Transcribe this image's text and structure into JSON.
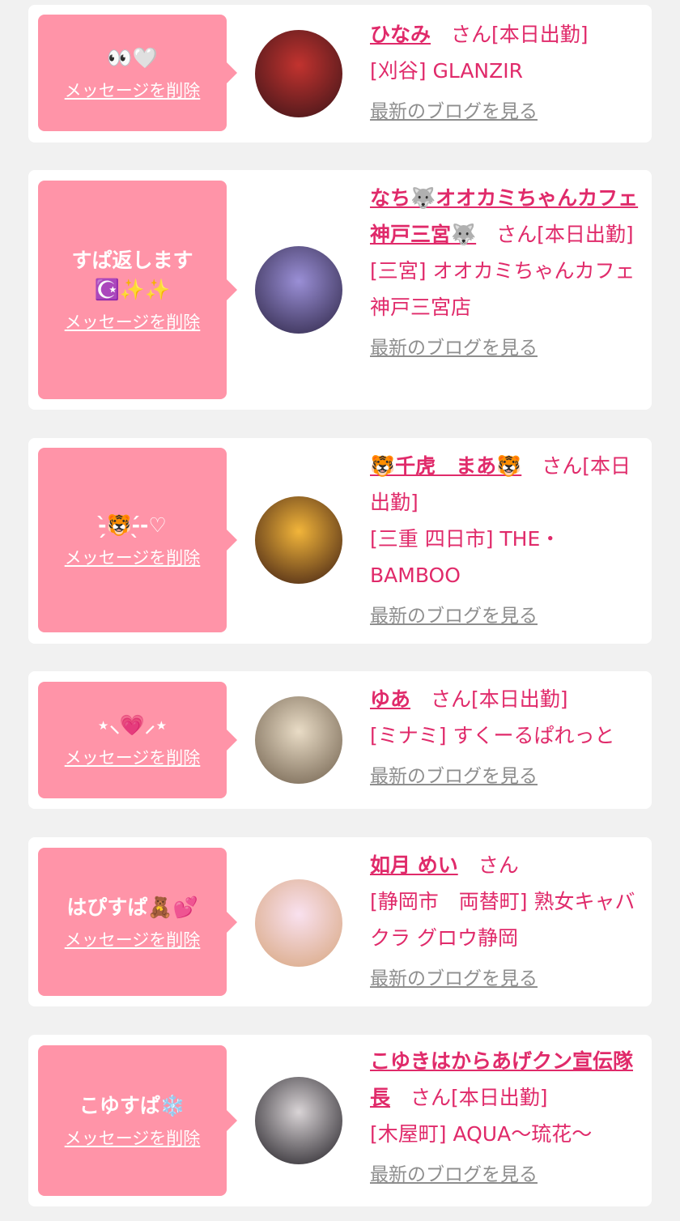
{
  "cards": [
    {
      "bubble_text": "👀🤍",
      "delete_label": "メッセージを削除",
      "name": "ひなみ",
      "suffix": "　さん[本日出勤]",
      "shop": "[刈谷] GLANZIR",
      "blog_label": "最新のブログを見る",
      "avatar_colors": [
        "#c2332f",
        "#3a1418"
      ]
    },
    {
      "bubble_text": "すぱ返します☪️✨✨",
      "delete_label": "メッセージを削除",
      "name": "なち🐺オオカミちゃんカフェ神戸三宮🐺",
      "suffix": "　さん[本日出勤]",
      "shop": "[三宮] オオカミちゃんカフェ神戸三宮店",
      "blog_label": "最新のブログを見る",
      "avatar_colors": [
        "#9a8fd6",
        "#2c2444"
      ]
    },
    {
      "bubble_text": "-̗̀🐯-̖́-♡",
      "delete_label": "メッセージを削除",
      "name": "🐯千虎　まあ🐯",
      "suffix": "　さん[本日出勤]",
      "shop": "[三重 四日市] THE・BAMBOO",
      "blog_label": "最新のブログを見る",
      "avatar_colors": [
        "#f2b53a",
        "#3b1b12"
      ]
    },
    {
      "bubble_text": "⋆⸜💗⸝⋆",
      "delete_label": "メッセージを削除",
      "name": "ゆあ",
      "suffix": "　さん[本日出勤]",
      "shop": "[ミナミ] すくーるぱれっと",
      "blog_label": "最新のブログを見る",
      "avatar_colors": [
        "#e9dcc6",
        "#6e5e4b"
      ]
    },
    {
      "bubble_text": "はぴすぱ🧸💕",
      "delete_label": "メッセージを削除",
      "name": "如月 めい",
      "suffix": "　さん",
      "shop": "[静岡市　両替町] 熟女キャバクラ グロウ静岡",
      "blog_label": "最新のブログを見る",
      "avatar_colors": [
        "#f9e1ef",
        "#d7a57d"
      ]
    },
    {
      "bubble_text": "こゆすぱ❄️",
      "delete_label": "メッセージを削除",
      "name": "こゆきはからあげクン宣伝隊長",
      "suffix": "　さん[本日出勤]",
      "shop": "[木屋町] AQUA〜琉花〜",
      "blog_label": "最新のブログを見る",
      "avatar_colors": [
        "#d9d4d6",
        "#1f1c22"
      ]
    }
  ]
}
